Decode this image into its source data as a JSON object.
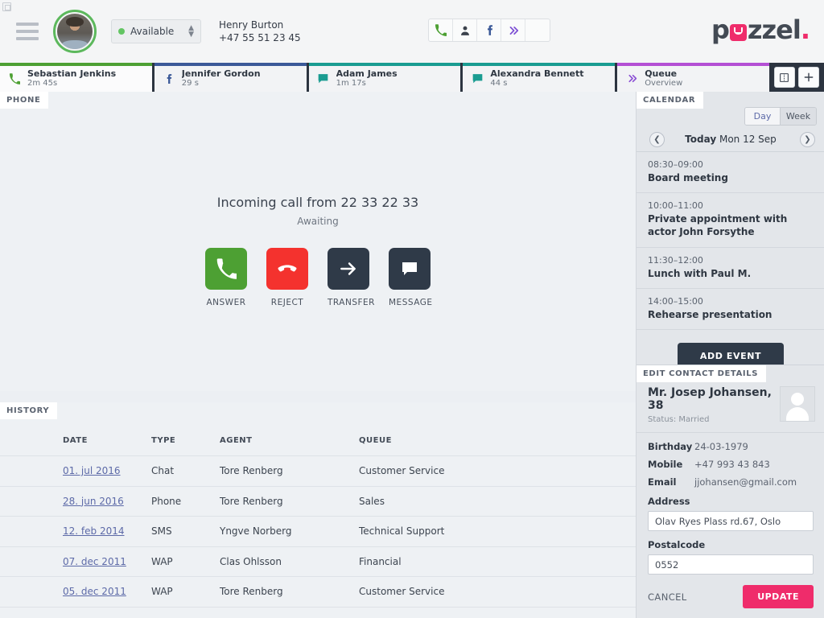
{
  "header": {
    "menu_icon": "hamburger-icon",
    "avatar": "agent-avatar",
    "status": {
      "label": "Available",
      "dot_color": "#63c563"
    },
    "agent": {
      "name": "Henry Burton",
      "phone": "+47 55 51 23 45"
    },
    "channels": [
      {
        "icon": "phone-icon",
        "color": "#4da033"
      },
      {
        "icon": "contact-person-icon",
        "color": "#3b424c"
      },
      {
        "icon": "facebook-icon",
        "color": "#3b5998"
      },
      {
        "icon": "chevrons-right-icon",
        "color": "#7d4fd4"
      },
      {
        "icon": "blank-slot",
        "color": ""
      }
    ],
    "brand": {
      "pre": "p",
      "tile": "u",
      "post": "zzel",
      "dot": ".",
      "accent": "#ef2c6b"
    }
  },
  "tabs": {
    "items": [
      {
        "title": "Sebastian Jenkins",
        "sub": "2m 45s",
        "icon": "phone-icon",
        "accent": "#4da033",
        "active": true
      },
      {
        "title": "Jennifer Gordon",
        "sub": "29 s",
        "icon": "facebook-icon",
        "accent": "#3b5998",
        "active": false
      },
      {
        "title": "Adam James",
        "sub": "1m 17s",
        "icon": "chat-bubble-icon",
        "accent": "#1a9c91",
        "active": false
      },
      {
        "title": "Alexandra Bennett",
        "sub": "44 s",
        "icon": "chat-bubble-icon",
        "accent": "#1a9c91",
        "active": false
      },
      {
        "title": "Queue",
        "sub": "Overview",
        "icon": "chevrons-right-icon",
        "accent": "#b44fd4",
        "active": false
      }
    ],
    "actions": [
      {
        "icon": "split-view-icon"
      },
      {
        "icon": "plus-icon"
      }
    ]
  },
  "phone_panel": {
    "label": "PHONE",
    "call_title": "Incoming call from 22 33 22 33",
    "call_status": "Awaiting",
    "actions": [
      {
        "label": "ANSWER",
        "icon": "phone-icon",
        "color": "#4da033"
      },
      {
        "label": "REJECT",
        "icon": "phone-hangup-icon",
        "color": "#f4322e"
      },
      {
        "label": "TRANSFER",
        "icon": "arrow-right-icon",
        "color": "#2f3a48"
      },
      {
        "label": "MESSAGE",
        "icon": "message-bubble-icon",
        "color": "#2f3a48"
      }
    ]
  },
  "history_panel": {
    "label": "HISTORY",
    "columns": [
      "DATE",
      "TYPE",
      "AGENT",
      "QUEUE"
    ],
    "rows": [
      {
        "date": "01. jul 2016",
        "type": "Chat",
        "agent": "Tore Renberg",
        "queue": "Customer Service"
      },
      {
        "date": "28. jun 2016",
        "type": "Phone",
        "agent": "Tore Renberg",
        "queue": "Sales"
      },
      {
        "date": "12. feb 2014",
        "type": "SMS",
        "agent": "Yngve Norberg",
        "queue": "Technical Support"
      },
      {
        "date": "07. dec 2011",
        "type": "WAP",
        "agent": "Clas Ohlsson",
        "queue": "Financial"
      },
      {
        "date": "05. dec 2011",
        "type": "WAP",
        "agent": "Tore Renberg",
        "queue": "Customer Service"
      }
    ]
  },
  "calendar": {
    "label": "CALENDAR",
    "view_day": "Day",
    "view_week": "Week",
    "prev_icon": "chevron-left-icon",
    "next_icon": "chevron-right-icon",
    "today_label": "Today",
    "date_label": "Mon 12 Sep",
    "events": [
      {
        "time": "08:30–09:00",
        "title": "Board meeting"
      },
      {
        "time": "10:00–11:00",
        "title": "Private appointment with actor John Forsythe"
      },
      {
        "time": "11:30–12:00",
        "title": "Lunch with Paul M."
      },
      {
        "time": "14:00–15:00",
        "title": "Rehearse presentation"
      }
    ],
    "add_event_label": "ADD EVENT"
  },
  "contact": {
    "label": "EDIT CONTACT DETAILS",
    "name": "Mr. Josep Johansen, 38",
    "status": "Status: Married",
    "fields": [
      {
        "label": "Birthday",
        "value": "24-03-1979"
      },
      {
        "label": "Mobile",
        "value": "+47 993 43 843"
      },
      {
        "label": "Email",
        "value": "jjohansen@gmail.com"
      }
    ],
    "address_label": "Address",
    "address_value": "Olav Ryes Plass rd.67, Oslo",
    "postalcode_label": "Postalcode",
    "postalcode_value": "0552",
    "cancel_label": "CANCEL",
    "update_label": "UPDATE"
  }
}
